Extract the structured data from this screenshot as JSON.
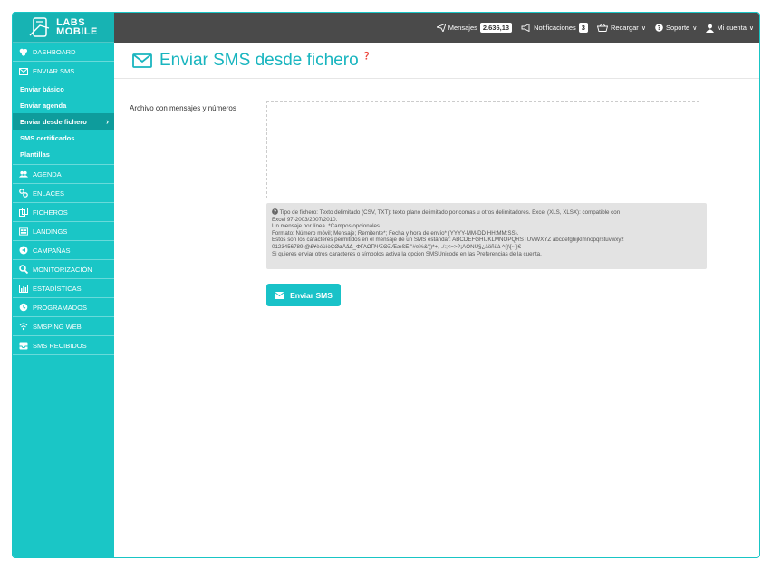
{
  "logo": {
    "line1": "LABS",
    "line2": "MOBILE"
  },
  "topbar": {
    "messages_label": "Mensajes",
    "messages_count": "2.636,13",
    "notifications_label": "Notificaciones",
    "notifications_count": "3",
    "recharge_label": "Recargar",
    "support_label": "Soporte",
    "account_label": "Mi cuenta"
  },
  "sidebar": {
    "dashboard": "DASHBOARD",
    "send_sms": "ENVIAR SMS",
    "sub": {
      "basic": "Enviar básico",
      "agenda": "Enviar agenda",
      "file": "Enviar desde fichero",
      "certified": "SMS certificados",
      "templates": "Plantillas"
    },
    "agenda": "AGENDA",
    "links": "ENLACES",
    "files": "FICHEROS",
    "landings": "LANDINGS",
    "campaigns": "CAMPAÑAS",
    "monitoring": "MONITORIZACIÓN",
    "stats": "ESTADÍSTICAS",
    "scheduled": "PROGRAMADOS",
    "smsping": "SMSPING WEB",
    "received": "SMS RECIBIDOS"
  },
  "main": {
    "title": "Enviar SMS desde fichero",
    "field_label": "Archivo con mensajes y números",
    "help": {
      "line1": "Tipo de fichero: Texto delimitado (CSV, TXT): texto plano delimitado por comas u otros delimitadores. Excel (XLS, XLSX): compatible con",
      "line2": "Excel 97-2003/2007/2010.",
      "line3": "Un mensaje por línea. *Campos opcionales.",
      "line4": "Formato: Número móvil; Mensaje; Remitente*; Fecha y hora de envío* (YYYY-MM-DD HH:MM:SS).",
      "line5": "Estos son los caracteres permitidos en el mensaje de un SMS estándar: ABCDEFGHIJKLMNOPQRSTUVWXYZ abcdefghijklmnopqrstuvwxyz",
      "line6": "0123456789 @£¥èéùìòÇØøÅåΔ_ΦΓΛΩΠΨΣΘΞÆæßÉ!\"#¤%&'()*+,-./:;<=>?¡ÄÖÑÜ§¿äöñüà ^{}\\[~]|€",
      "line7": "Si quieres enviar otros caracteres o símbolos activa la opcion SMSUnicode en las Preferencias de la cuenta."
    },
    "send_button": "Enviar SMS"
  },
  "colors": {
    "accent": "#1ac6c6",
    "topbar": "#4a4a4a",
    "title": "#19b5bf"
  }
}
